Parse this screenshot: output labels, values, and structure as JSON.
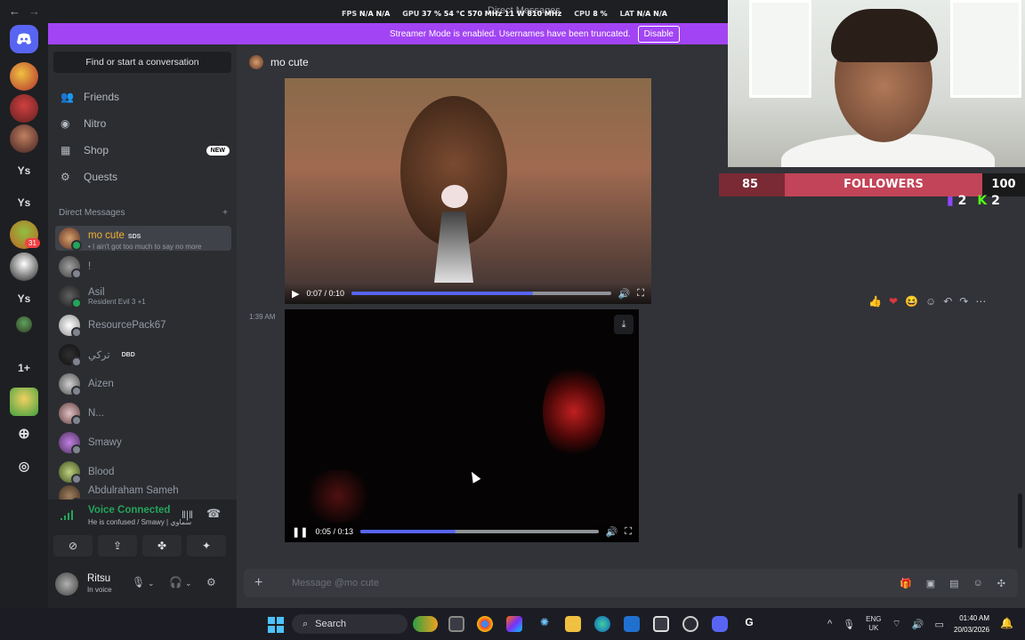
{
  "topbar": {
    "title": "Direct Messages",
    "stats": [
      {
        "label": "FPS",
        "value": "N/A  N/A"
      },
      {
        "label": "GPU",
        "value": "37 %  54 °C  570 MHz  11 W  810 MHz"
      },
      {
        "label": "CPU",
        "value": "8 %"
      },
      {
        "label": "LAT",
        "value": "N/A  N/A"
      }
    ]
  },
  "banner": {
    "text": "Streamer Mode is enabled. Usernames have been truncated.",
    "button": "Disable"
  },
  "rail": {
    "items": [
      "Ys",
      "Ys",
      "31",
      "Ys",
      "1+"
    ],
    "badge": "31"
  },
  "sidebar": {
    "search_label": "Find or start a conversation",
    "nav": [
      {
        "label": "Friends",
        "icon": "friends-icon"
      },
      {
        "label": "Nitro",
        "icon": "nitro-icon"
      },
      {
        "label": "Shop",
        "icon": "shop-icon",
        "badge": "NEW"
      },
      {
        "label": "Quests",
        "icon": "quests-icon"
      }
    ],
    "dm_header": "Direct Messages",
    "dms": [
      {
        "name": "mo cute",
        "tag": "SDS",
        "sub": "• I ain't got too much to say no more",
        "active": true
      },
      {
        "name": "!",
        "sub": ""
      },
      {
        "name": "Asil",
        "sub": "Resident Evil 3 +1"
      },
      {
        "name": "ResourcePack67",
        "sub": ""
      },
      {
        "name": "تركي",
        "tag": "DBD",
        "sub": ""
      },
      {
        "name": "Aizen",
        "sub": ""
      },
      {
        "name": "N...",
        "sub": ""
      },
      {
        "name": "Smawy",
        "sub": ""
      },
      {
        "name": "Blood",
        "sub": ""
      },
      {
        "name": "Abdulraham Sameh",
        "sub": ""
      }
    ]
  },
  "voice": {
    "title": "Voice Connected",
    "sub": "He is confused / Smawy | سماوي"
  },
  "user": {
    "name": "Ritsu",
    "status": "In voice"
  },
  "chat": {
    "header_name": "mo cute",
    "video1": {
      "time": "0:07 / 0:10",
      "progress": 0.7
    },
    "message_time": "1:39 AM",
    "video2": {
      "time": "0:05 / 0:13",
      "progress": 0.4
    },
    "composer_placeholder": "Message @mo cute",
    "reactions": [
      "👍",
      "❤",
      "😆",
      "☺",
      "↶",
      "↷",
      "⋯"
    ]
  },
  "overlay": {
    "followers_current": "85",
    "followers_label": "FOLLOWERS",
    "followers_goal": "100",
    "twitch_count": "2",
    "kick_count": "2"
  },
  "taskbar": {
    "search": "Search",
    "lang_top": "ENG",
    "lang_bottom": "UK",
    "time": "01:40 AM",
    "date": "20/03/2026"
  }
}
